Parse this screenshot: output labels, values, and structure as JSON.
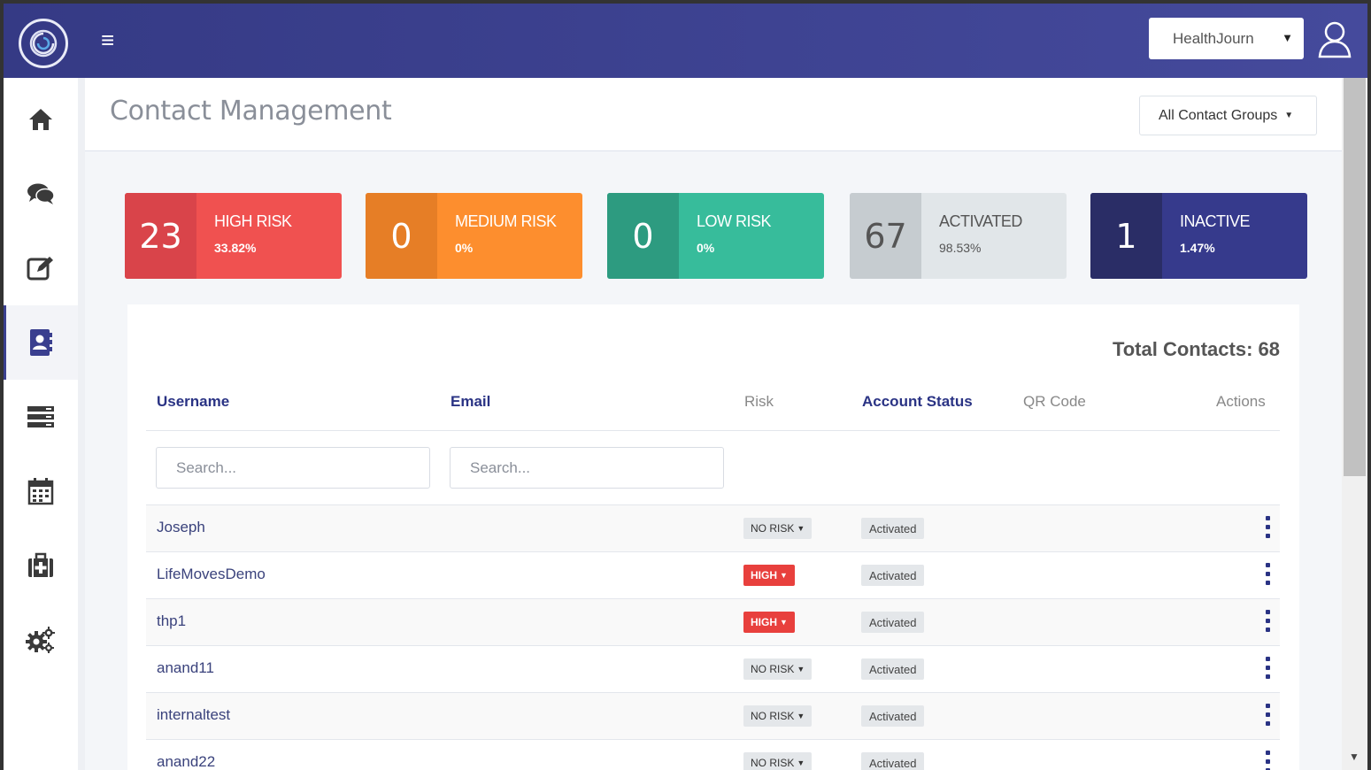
{
  "topbar": {
    "org_select_value": "HealthJourn"
  },
  "sidebar": {
    "items": [
      {
        "name": "home-icon"
      },
      {
        "name": "chat-icon"
      },
      {
        "name": "edit-icon"
      },
      {
        "name": "contacts-icon"
      },
      {
        "name": "list-icon"
      },
      {
        "name": "calendar-icon"
      },
      {
        "name": "medkit-icon"
      },
      {
        "name": "settings-icon"
      }
    ]
  },
  "page": {
    "title": "Contact Management",
    "group_filter": "All Contact Groups"
  },
  "stats": [
    {
      "count": "23",
      "label": "HIGH RISK",
      "pct": "33.82%",
      "color": "#f05150",
      "num_color": "#d9444a"
    },
    {
      "count": "0",
      "label": "MEDIUM RISK",
      "pct": "0%",
      "color": "#fd8e2e",
      "num_color": "#e67e26"
    },
    {
      "count": "0",
      "label": "LOW RISK",
      "pct": "0%",
      "color": "#37bc9b",
      "num_color": "#2d9b80"
    },
    {
      "count": "67",
      "label": "ACTIVATED",
      "pct": "98.53%",
      "color": "#e1e6e9",
      "num_color": "#c6ccd0"
    },
    {
      "count": "1",
      "label": "INACTIVE",
      "pct": "1.47%",
      "color": "#363a8c",
      "num_color": "#2a2d66"
    }
  ],
  "table": {
    "total": "Total Contacts: 68",
    "columns": {
      "username": "Username",
      "email": "Email",
      "risk": "Risk",
      "status": "Account Status",
      "qr": "QR Code",
      "actions": "Actions"
    },
    "search_placeholder": "Search...",
    "rows": [
      {
        "username": "Joseph",
        "risk": "NO RISK",
        "status": "Activated"
      },
      {
        "username": "LifeMovesDemo",
        "risk": "HIGH",
        "status": "Activated"
      },
      {
        "username": "thp1",
        "risk": "HIGH",
        "status": "Activated"
      },
      {
        "username": "anand11",
        "risk": "NO RISK",
        "status": "Activated"
      },
      {
        "username": "internaltest",
        "risk": "NO RISK",
        "status": "Activated"
      },
      {
        "username": "anand22",
        "risk": "NO RISK",
        "status": "Activated"
      }
    ]
  }
}
